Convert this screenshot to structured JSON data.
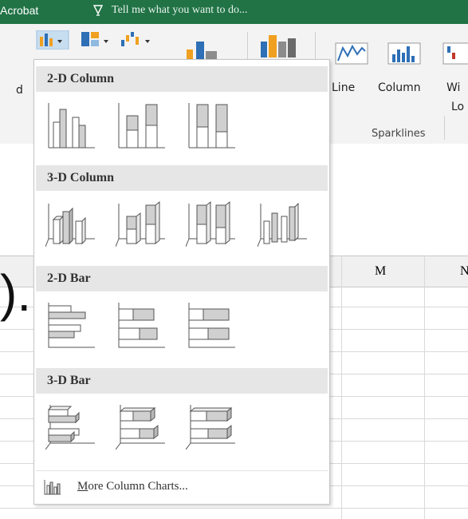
{
  "titlebar": {
    "app_name": "Acrobat",
    "tell_me": "Tell me what you want to do..."
  },
  "ribbon": {
    "left_partial_label": "d",
    "sparklines": {
      "line_label": "Line",
      "column_label": "Column",
      "winloss_partial_top": "Wi",
      "winloss_partial_bottom": "Lo",
      "group_label": "Sparklines"
    }
  },
  "sheet": {
    "column_headers": [
      "M",
      "N"
    ]
  },
  "dropdown": {
    "sections": [
      {
        "title": "2-D Column",
        "icons": [
          "clustered-column-icon",
          "stacked-column-icon",
          "100-stacked-column-icon"
        ]
      },
      {
        "title": "3-D Column",
        "icons": [
          "3d-clustered-column-icon",
          "3d-stacked-column-icon",
          "3d-100-stacked-column-icon",
          "3d-column-icon"
        ]
      },
      {
        "title": "2-D Bar",
        "icons": [
          "clustered-bar-icon",
          "stacked-bar-icon",
          "100-stacked-bar-icon"
        ]
      },
      {
        "title": "3-D Bar",
        "icons": [
          "3d-clustered-bar-icon",
          "3d-stacked-bar-icon",
          "3d-100-stacked-bar-icon"
        ]
      }
    ],
    "more_label_first": "M",
    "more_label_rest": "ore Column Charts..."
  },
  "colors": {
    "excel_green": "#217346",
    "chart_gray": "#d0d0d0",
    "chart_outline": "#555555"
  }
}
